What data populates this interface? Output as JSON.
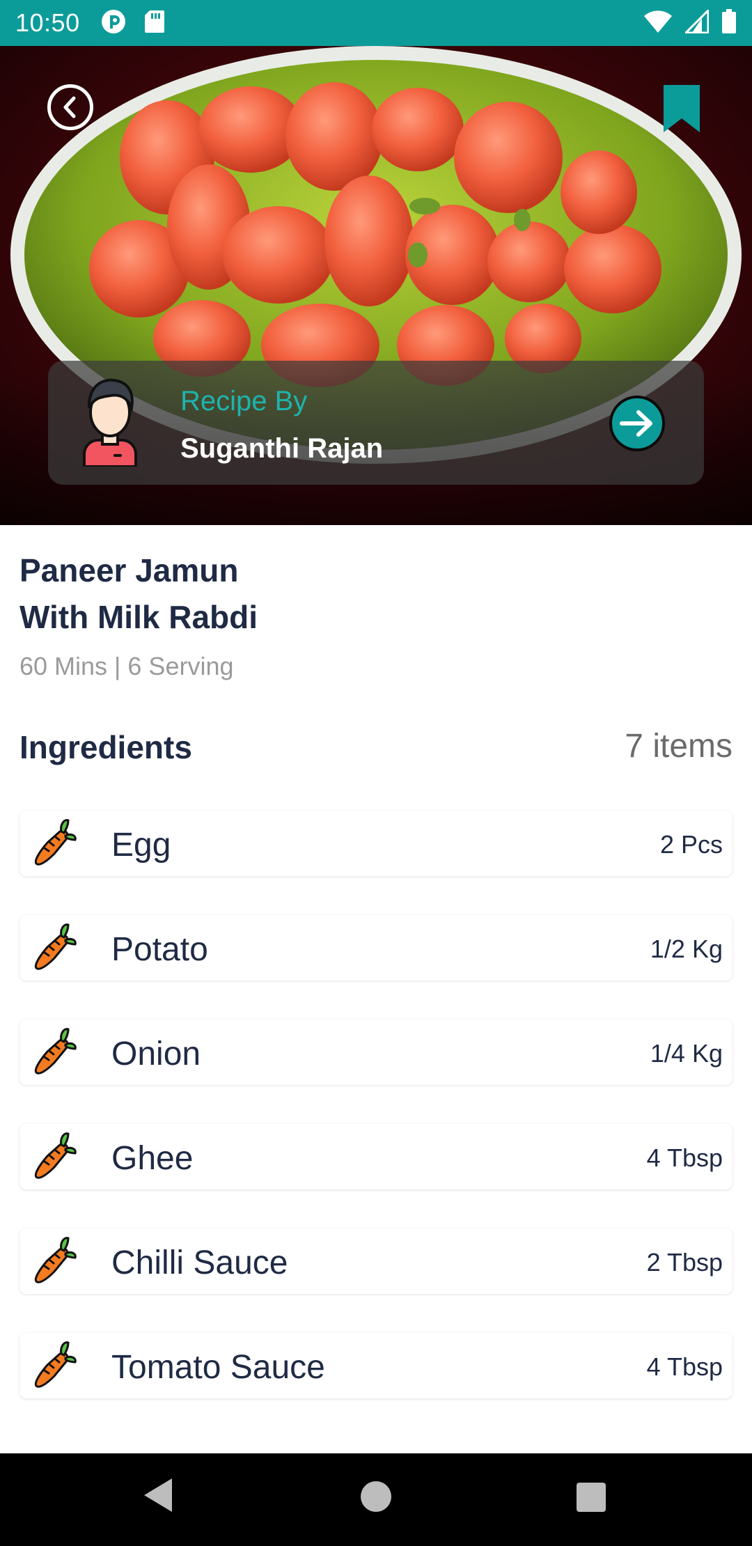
{
  "status_bar": {
    "time": "10:50",
    "left_icons": [
      "pocket-casts-icon",
      "sd-card-icon"
    ],
    "right_icons": [
      "wifi-icon",
      "cell-signal-icon",
      "battery-icon"
    ]
  },
  "hero": {
    "back_icon": "chevron-left-icon",
    "bookmark_icon": "bookmark-icon",
    "accent_color": "#0b9c9a"
  },
  "author": {
    "label": "Recipe By",
    "name": "Suganthi Rajan",
    "arrow_icon": "arrow-right-icon"
  },
  "recipe": {
    "title_line1": "Paneer Jamun",
    "title_line2": "With Milk Rabdi",
    "meta": "60 Mins | 6 Serving"
  },
  "ingredients": {
    "heading": "Ingredients",
    "count": "7 items",
    "items": [
      {
        "name": "Egg",
        "qty": "2 Pcs",
        "icon": "carrot-icon"
      },
      {
        "name": "Potato",
        "qty": "1/2 Kg",
        "icon": "carrot-icon"
      },
      {
        "name": "Onion",
        "qty": "1/4 Kg",
        "icon": "carrot-icon"
      },
      {
        "name": "Ghee",
        "qty": "4 Tbsp",
        "icon": "carrot-icon"
      },
      {
        "name": "Chilli Sauce",
        "qty": "2 Tbsp",
        "icon": "carrot-icon"
      },
      {
        "name": "Tomato Sauce",
        "qty": "4 Tbsp",
        "icon": "carrot-icon"
      }
    ]
  },
  "nav_bar": {
    "buttons": [
      "back-triangle-icon",
      "home-circle-icon",
      "recents-square-icon"
    ]
  }
}
